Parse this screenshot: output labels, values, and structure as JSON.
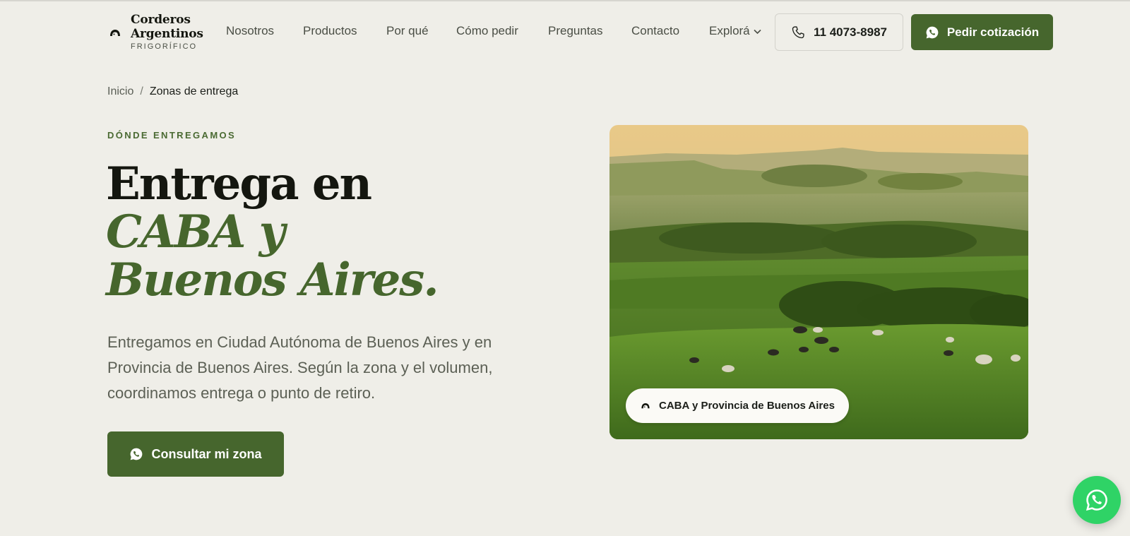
{
  "brand": {
    "name_line1": "Corderos",
    "name_line2": "Argentinos",
    "tagline": "FRIGORÍFICO",
    "accent": "#46662d",
    "whatsapp_green": "#2fd366"
  },
  "nav": {
    "items": [
      {
        "label": "Nosotros"
      },
      {
        "label": "Productos"
      },
      {
        "label": "Por qué"
      },
      {
        "label": "Cómo pedir"
      },
      {
        "label": "Preguntas"
      },
      {
        "label": "Contacto"
      }
    ],
    "explore_label": "Explorá",
    "phone_label": "11 4073-8987",
    "quote_label": "Pedir cotización"
  },
  "breadcrumb": {
    "home": "Inicio",
    "separator": "/",
    "current": "Zonas de entrega"
  },
  "hero": {
    "eyebrow": "DÓNDE ENTREGAMOS",
    "title_line1": "Entrega en",
    "title_line2": "CABA y",
    "title_line3": "Buenos Aires.",
    "lead": "Entregamos en Ciudad Autónoma de Buenos Aires y en Provincia de Buenos Aires. Según la zona y el volumen, coordinamos entrega o punto de retiro.",
    "cta_label": "Consultar mi zona",
    "image_badge": "CABA y Provincia de Buenos Aires"
  },
  "icons": {
    "logo": "lamb-icon",
    "phone": "phone-icon",
    "whatsapp": "whatsapp-icon",
    "chevron": "chevron-down-icon"
  }
}
